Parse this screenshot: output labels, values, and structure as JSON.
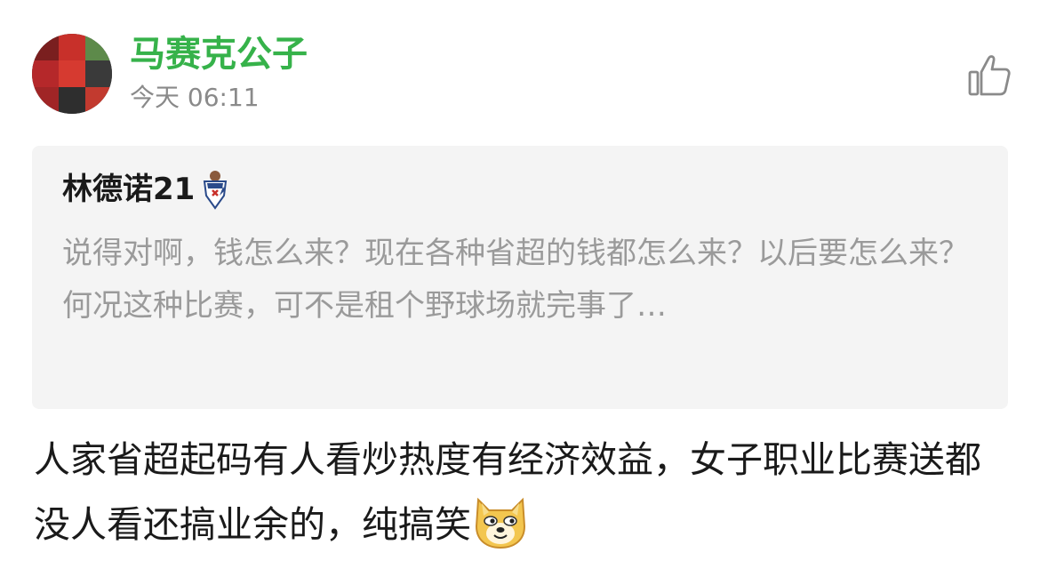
{
  "post": {
    "author": "马赛克公子",
    "time": "今天 06:11"
  },
  "quote": {
    "author": "林德诺21",
    "text": "说得对啊，钱怎么来？现在各种省超的钱都怎么来？以后要怎么来？何况这种比赛，可不是租个野球场就完事了…"
  },
  "comment": {
    "text": "人家省超起码有人看炒热度有经济效益，女子职业比赛送都没人看还搞业余的，纯搞笑"
  },
  "icons": {
    "like": "thumbs-up-icon",
    "badge": "team-badge-icon",
    "emoji": "doge-emoji"
  },
  "colors": {
    "username": "#36b24a",
    "timestamp": "#8a8a8a",
    "quote_bg": "#f4f4f4",
    "quote_text": "#9a9a9a",
    "body_text": "#1a1a1a"
  }
}
